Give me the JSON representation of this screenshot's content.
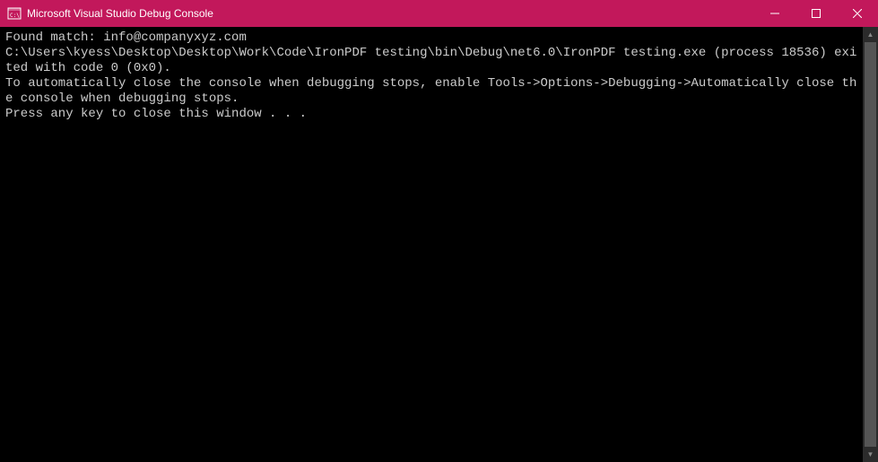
{
  "window": {
    "title": "Microsoft Visual Studio Debug Console"
  },
  "console": {
    "line1": "Found match: info@companyxyz.com",
    "blank1": "",
    "line2": "C:\\Users\\kyess\\Desktop\\Desktop\\Work\\Code\\IronPDF testing\\bin\\Debug\\net6.0\\IronPDF testing.exe (process 18536) exited with code 0 (0x0).",
    "line3": "To automatically close the console when debugging stops, enable Tools->Options->Debugging->Automatically close the console when debugging stops.",
    "line4": "Press any key to close this window . . ."
  }
}
